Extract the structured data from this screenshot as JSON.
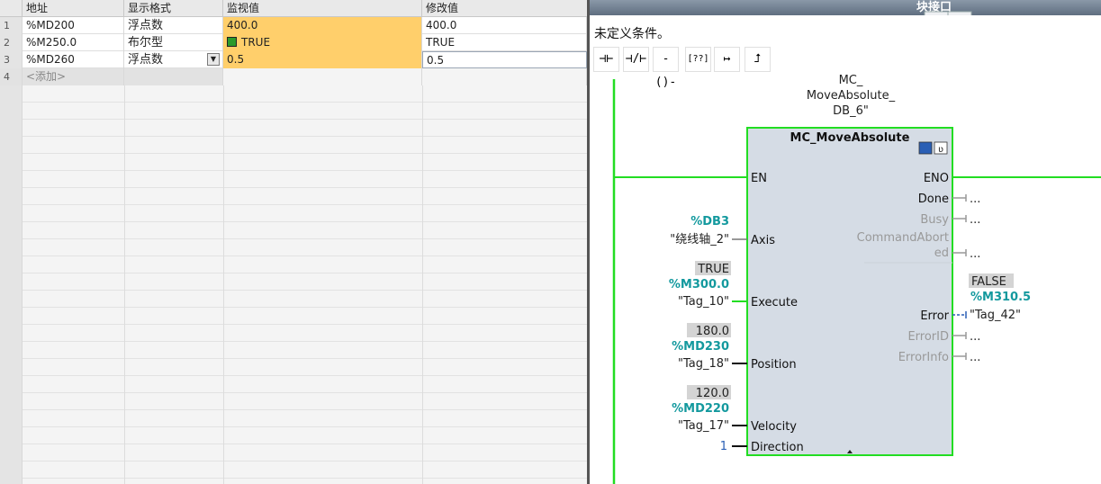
{
  "watch_table": {
    "headers": {
      "address": "地址",
      "format": "显示格式",
      "monitor": "监视值",
      "modify": "修改值"
    },
    "rows": [
      {
        "index": "1",
        "address": "%MD200",
        "format": "浮点数",
        "monitor": "400.0",
        "modify": "400.0"
      },
      {
        "index": "2",
        "address": "%M250.0",
        "format": "布尔型",
        "monitor": "TRUE",
        "modify": "TRUE"
      },
      {
        "index": "3",
        "address": "%MD260",
        "format": "浮点数",
        "monitor": "0.5",
        "modify": "0.5"
      },
      {
        "index": "4",
        "address": "<添加>",
        "format": "",
        "monitor": "",
        "modify": ""
      }
    ]
  },
  "editor": {
    "title": "块接口",
    "condition_text": "未定义条件。",
    "toolbar": [
      {
        "icon": "no-contact-icon",
        "glyph": "⊣⊢"
      },
      {
        "icon": "nc-contact-icon",
        "glyph": "⊣/⊢"
      },
      {
        "icon": "coil-icon",
        "glyph": "-()-"
      },
      {
        "icon": "empty-box-icon",
        "glyph": "[??]"
      },
      {
        "icon": "open-branch-icon",
        "glyph": "↦"
      },
      {
        "icon": "close-branch-icon",
        "glyph": "⮥"
      }
    ],
    "block": {
      "db_line1": "MC_",
      "db_line2": "MoveAbsolute_",
      "db_line3": "DB_6\"",
      "name": "MC_MoveAbsolute",
      "pins_in": {
        "en": "EN",
        "axis": "Axis",
        "execute": "Execute",
        "position": "Position",
        "velocity": "Velocity",
        "direction": "Direction"
      },
      "pins_out": {
        "eno": "ENO",
        "done": "Done",
        "busy": "Busy",
        "command_aborted_1": "CommandAbort",
        "command_aborted_2": "ed",
        "error": "Error",
        "error_id": "ErrorID",
        "error_info": "ErrorInfo"
      },
      "axis_addr": "%DB3",
      "axis_tag": "\"绕线轴_2\"",
      "execute_val": "TRUE",
      "execute_addr": "%M300.0",
      "execute_tag": "\"Tag_10\"",
      "position_val": "180.0",
      "position_addr": "%MD230",
      "position_tag": "\"Tag_18\"",
      "velocity_val": "120.0",
      "velocity_addr": "%MD220",
      "velocity_tag": "\"Tag_17\"",
      "direction_val": "1",
      "error_val": "FALSE",
      "error_addr": "%M310.5",
      "error_tag": "\"Tag_42\"",
      "unconnected": "..."
    }
  },
  "colors": {
    "accent_green": "#22dd22",
    "address_teal": "#13999e",
    "monitor_orange": "#ffcf6b",
    "block_fill": "#d5dce5"
  }
}
